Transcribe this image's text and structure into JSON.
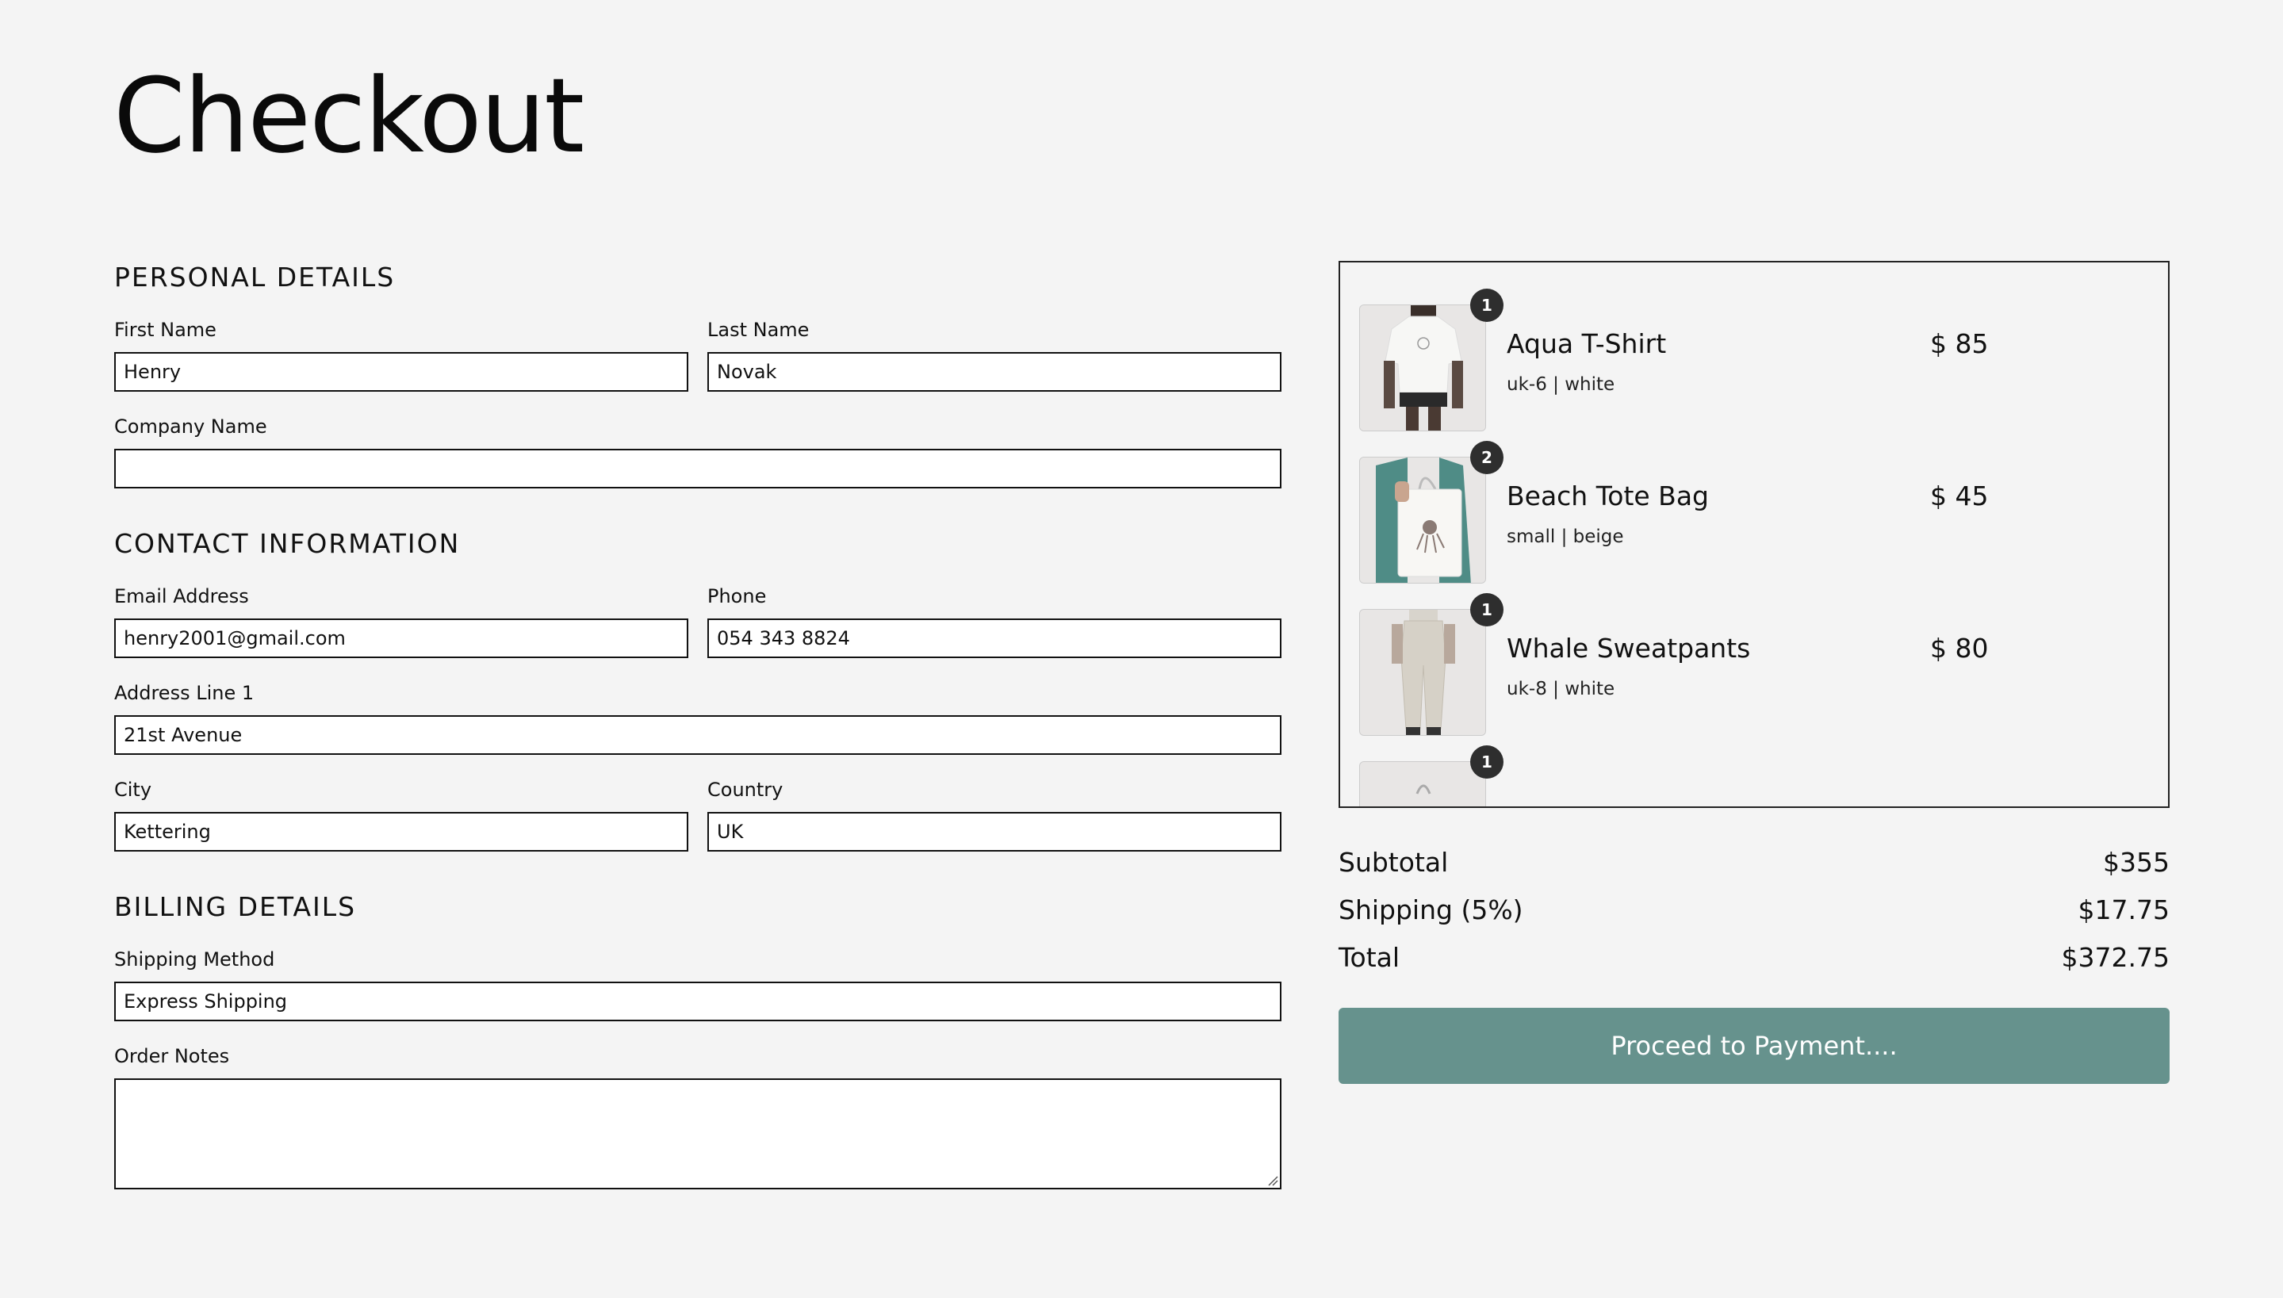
{
  "page": {
    "title": "Checkout"
  },
  "sections": {
    "personal": "PERSONAL DETAILS",
    "contact": "CONTACT INFORMATION",
    "billing": "BILLING DETAILS"
  },
  "fields": {
    "first_name": {
      "label": "First Name",
      "value": "Henry"
    },
    "last_name": {
      "label": "Last Name",
      "value": "Novak"
    },
    "company": {
      "label": "Company Name",
      "value": ""
    },
    "email": {
      "label": "Email Address",
      "value": "henry2001@gmail.com"
    },
    "phone": {
      "label": "Phone",
      "value": "054 343 8824"
    },
    "address1": {
      "label": "Address Line 1",
      "value": "21st Avenue"
    },
    "city": {
      "label": "City",
      "value": "Kettering"
    },
    "country": {
      "label": "Country",
      "value": "UK"
    },
    "shipping_method": {
      "label": "Shipping Method",
      "value": "Express Shipping"
    },
    "order_notes": {
      "label": "Order Notes",
      "value": ""
    }
  },
  "cart": {
    "items": [
      {
        "qty": "1",
        "name": "Aqua T-Shirt",
        "variant": "uk-6 | white",
        "price": "$ 85"
      },
      {
        "qty": "2",
        "name": "Beach Tote Bag",
        "variant": "small | beige",
        "price": "$ 45"
      },
      {
        "qty": "1",
        "name": "Whale Sweatpants",
        "variant": "uk-8 | white",
        "price": "$ 80"
      },
      {
        "qty": "1",
        "name": "",
        "variant": "",
        "price": ""
      }
    ]
  },
  "summary": {
    "subtotal_label": "Subtotal",
    "subtotal_value": "$355",
    "shipping_label": "Shipping (5%)",
    "shipping_value": "$17.75",
    "total_label": "Total",
    "total_value": "$372.75"
  },
  "actions": {
    "pay_label": "Proceed to Payment...."
  },
  "colors": {
    "accent": "#66928d",
    "badge": "#2e2e2e",
    "background": "#f4f4f4"
  }
}
